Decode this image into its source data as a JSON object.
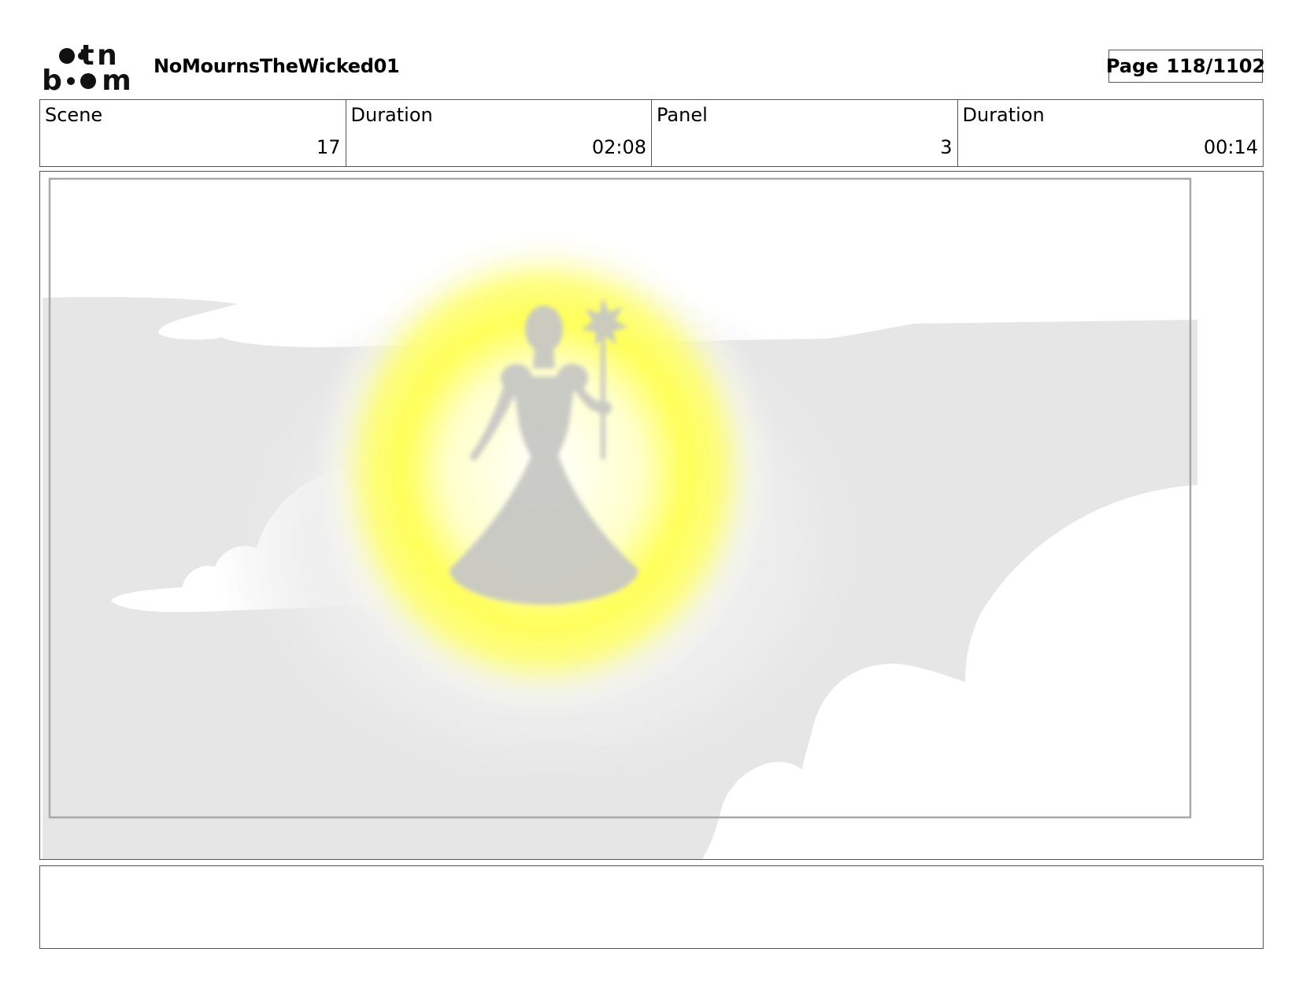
{
  "header": {
    "logo_text": "toon boom",
    "project_name": "NoMournsTheWicked01",
    "page_label": "Page",
    "page_number": "118/1102"
  },
  "info": {
    "scene_label": "Scene",
    "scene_value": "17",
    "scene_duration_label": "Duration",
    "scene_duration_value": "02:08",
    "panel_label": "Panel",
    "panel_value": "3",
    "panel_duration_label": "Duration",
    "panel_duration_value": "00:14"
  },
  "panel_image": {
    "icon": "glowing-figure-in-clouds",
    "colors": {
      "sky": "#ffffff",
      "cloud_shadow": "#e6e6e6",
      "glow": "#ffff4d",
      "figure": "#c9c9c9"
    }
  },
  "caption": {
    "text": ""
  }
}
